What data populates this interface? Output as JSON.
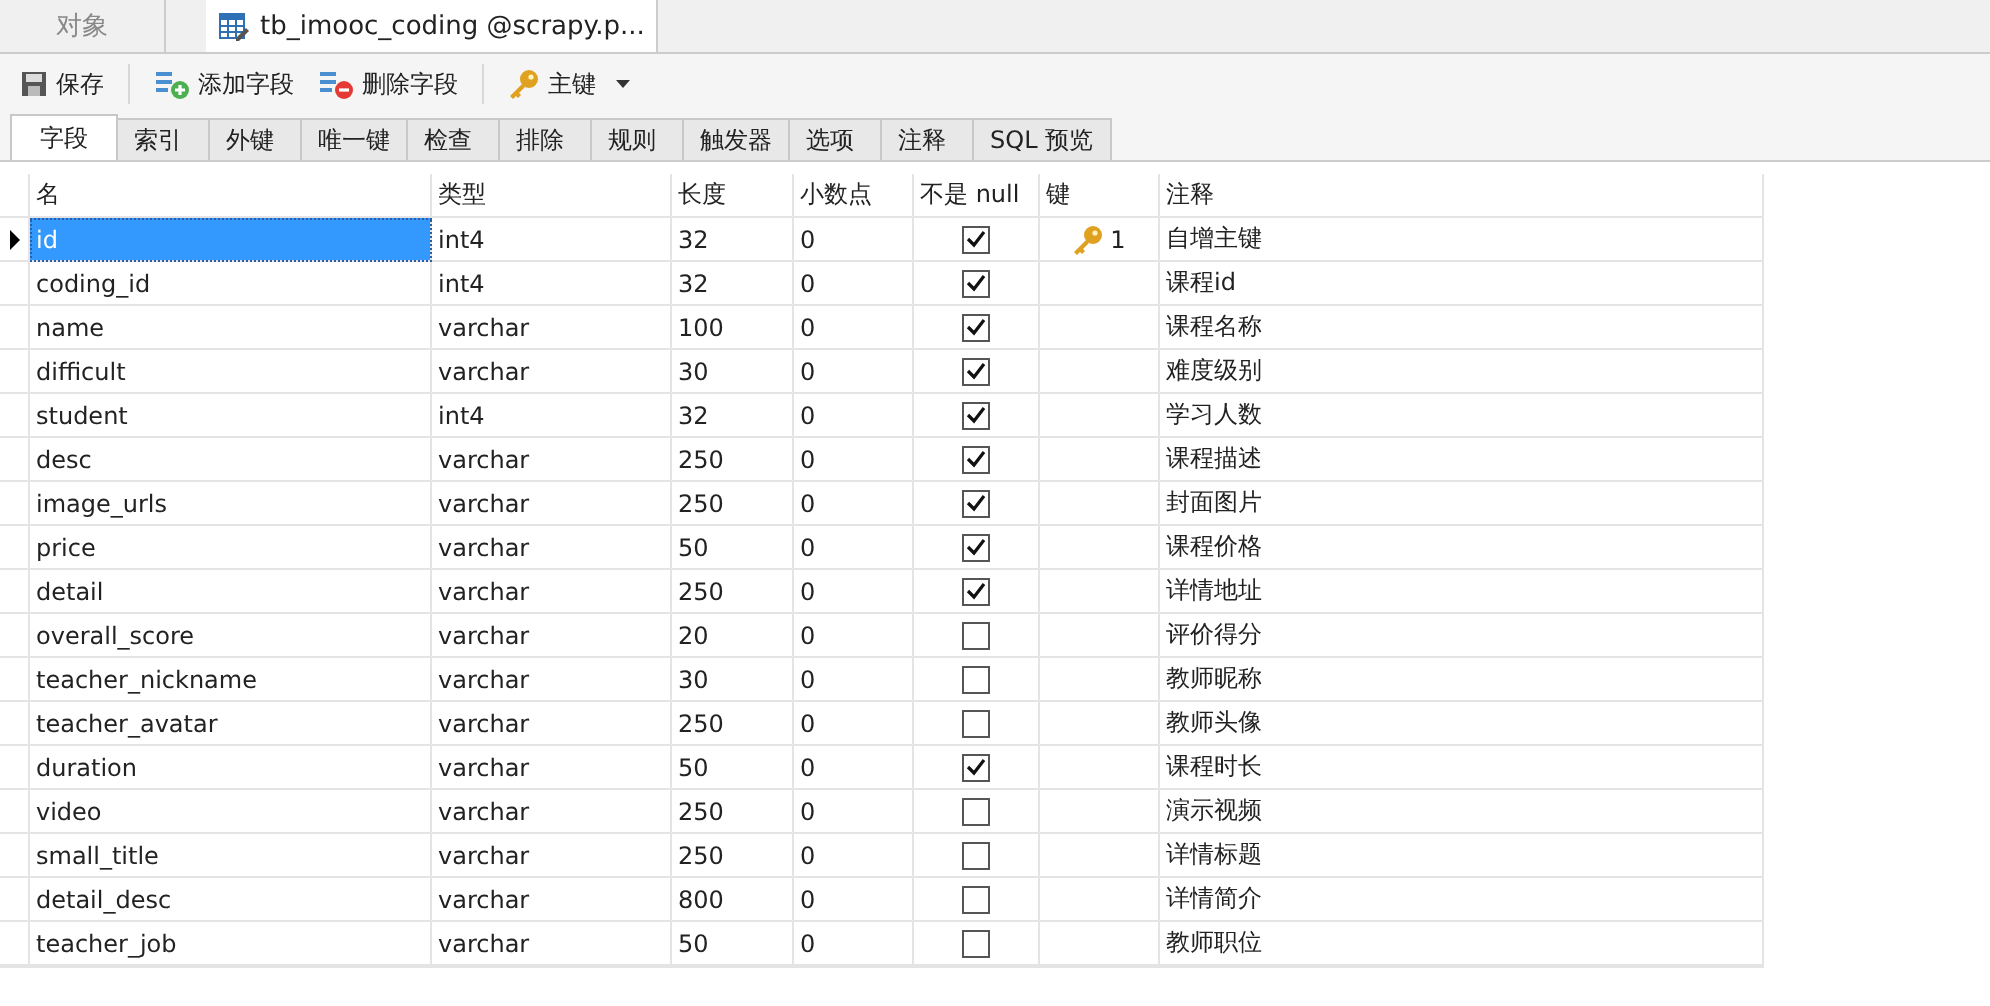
{
  "doc_tabs": [
    {
      "label": "对象",
      "selected": false
    },
    {
      "label": "tb_imooc_coding @scrapy.p...",
      "selected": true
    }
  ],
  "toolbar": [
    {
      "kind": "save",
      "label": "保存"
    },
    {
      "kind": "add",
      "label": "添加字段"
    },
    {
      "kind": "delete",
      "label": "删除字段"
    },
    {
      "kind": "key",
      "label": "主键",
      "dropdown": true
    }
  ],
  "tabs": [
    {
      "label": "字段",
      "selected": true
    },
    {
      "label": "索引",
      "selected": false
    },
    {
      "label": "外键",
      "selected": false
    },
    {
      "label": "唯一键",
      "selected": false
    },
    {
      "label": "检查",
      "selected": false
    },
    {
      "label": "排除",
      "selected": false
    },
    {
      "label": "规则",
      "selected": false
    },
    {
      "label": "触发器",
      "selected": false
    },
    {
      "label": "选项",
      "selected": false
    },
    {
      "label": "注释",
      "selected": false
    },
    {
      "label": "SQL 预览",
      "selected": false
    }
  ],
  "table": {
    "columns": [
      "名",
      "类型",
      "长度",
      "小数点",
      "不是 null",
      "键",
      "注释"
    ],
    "rows": [
      {
        "name": "id",
        "type": "int4",
        "length": "32",
        "decimals": "0",
        "not_null": true,
        "key": "1",
        "comment": "自增主键",
        "selected": true
      },
      {
        "name": "coding_id",
        "type": "int4",
        "length": "32",
        "decimals": "0",
        "not_null": true,
        "comment": "课程id",
        "selected": false
      },
      {
        "name": "name",
        "type": "varchar",
        "length": "100",
        "decimals": "0",
        "not_null": true,
        "comment": "课程名称",
        "selected": false
      },
      {
        "name": "difficult",
        "type": "varchar",
        "length": "30",
        "decimals": "0",
        "not_null": true,
        "comment": "难度级别",
        "selected": false
      },
      {
        "name": "student",
        "type": "int4",
        "length": "32",
        "decimals": "0",
        "not_null": true,
        "comment": "学习人数",
        "selected": false
      },
      {
        "name": "desc",
        "type": "varchar",
        "length": "250",
        "decimals": "0",
        "not_null": true,
        "comment": "课程描述",
        "selected": false
      },
      {
        "name": "image_urls",
        "type": "varchar",
        "length": "250",
        "decimals": "0",
        "not_null": true,
        "comment": "封面图片",
        "selected": false
      },
      {
        "name": "price",
        "type": "varchar",
        "length": "50",
        "decimals": "0",
        "not_null": true,
        "comment": "课程价格",
        "selected": false
      },
      {
        "name": "detail",
        "type": "varchar",
        "length": "250",
        "decimals": "0",
        "not_null": true,
        "comment": "详情地址",
        "selected": false
      },
      {
        "name": "overall_score",
        "type": "varchar",
        "length": "20",
        "decimals": "0",
        "not_null": false,
        "comment": "评价得分",
        "selected": false
      },
      {
        "name": "teacher_nickname",
        "type": "varchar",
        "length": "30",
        "decimals": "0",
        "not_null": false,
        "comment": "教师昵称",
        "selected": false
      },
      {
        "name": "teacher_avatar",
        "type": "varchar",
        "length": "250",
        "decimals": "0",
        "not_null": false,
        "comment": "教师头像",
        "selected": false
      },
      {
        "name": "duration",
        "type": "varchar",
        "length": "50",
        "decimals": "0",
        "not_null": true,
        "comment": "课程时长",
        "selected": false
      },
      {
        "name": "video",
        "type": "varchar",
        "length": "250",
        "decimals": "0",
        "not_null": false,
        "comment": "演示视频",
        "selected": false
      },
      {
        "name": "small_title",
        "type": "varchar",
        "length": "250",
        "decimals": "0",
        "not_null": false,
        "comment": "详情标题",
        "selected": false
      },
      {
        "name": "detail_desc",
        "type": "varchar",
        "length": "800",
        "decimals": "0",
        "not_null": false,
        "comment": "详情简介",
        "selected": false
      },
      {
        "name": "teacher_job",
        "type": "varchar",
        "length": "50",
        "decimals": "0",
        "not_null": false,
        "comment": "教师职位",
        "selected": false
      }
    ]
  }
}
